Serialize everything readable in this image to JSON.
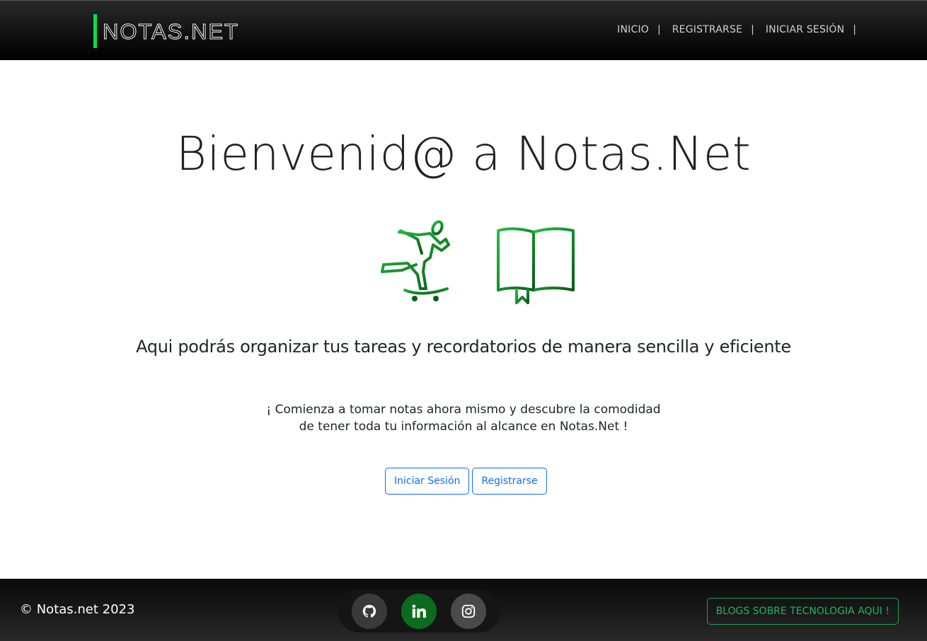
{
  "header": {
    "brand": "NOTAS.NET",
    "nav": [
      {
        "label": "INICIO"
      },
      {
        "label": "REGISTRARSE"
      },
      {
        "label": "INICIAR SESIÓN"
      }
    ],
    "separator": "|"
  },
  "hero": {
    "title": "Bienvenid@ a Notas.Net",
    "illustrations": [
      "skateboarder-icon",
      "open-book-icon"
    ],
    "accent_colors": [
      "#1fa63a",
      "#0b6b1f"
    ],
    "lead": "Aqui podrás organizar tus tareas y recordatorios de manera sencilla y eficiente",
    "sub_line1": "¡ Comienza a tomar notas ahora mismo y descubre la comodidad",
    "sub_line2": "de tener toda tu información al alcance en Notas.Net !",
    "login_label": "Iniciar Sesión",
    "register_label": "Registrarse"
  },
  "footer": {
    "copyright": "© Notas.net 2023",
    "social": [
      "github-icon",
      "linkedin-icon",
      "instagram-icon"
    ],
    "blogs_label": "BLOGS SOBRE TECNOLOGIA AQUI !"
  }
}
